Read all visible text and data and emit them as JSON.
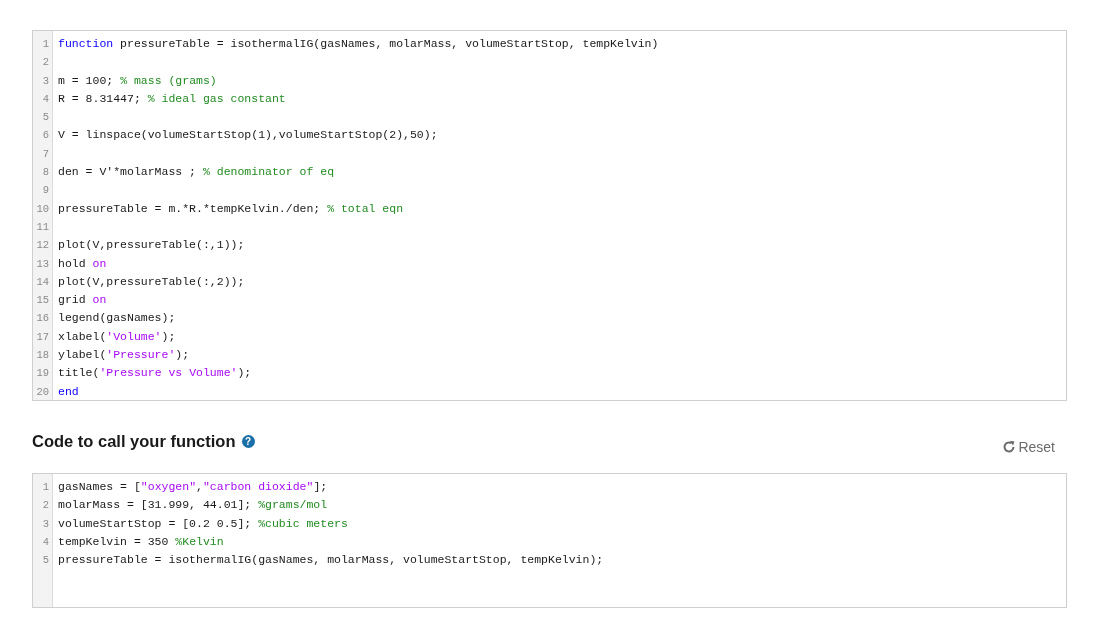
{
  "function_editor": {
    "lines": [
      {
        "number": "1",
        "tokens": [
          {
            "kind": "keyword",
            "text": "function"
          },
          {
            "kind": "code",
            "text": " pressureTable = isothermalIG(gasNames, molarMass, volumeStartStop, tempKelvin)"
          }
        ]
      },
      {
        "number": "2"
      },
      {
        "number": "3",
        "tokens": [
          {
            "kind": "code",
            "text": "m = 100; "
          },
          {
            "kind": "comment",
            "text": "% mass (grams)"
          }
        ]
      },
      {
        "number": "4",
        "tokens": [
          {
            "kind": "code",
            "text": "R = 8.31447; "
          },
          {
            "kind": "comment",
            "text": "% ideal gas constant"
          }
        ]
      },
      {
        "number": "5"
      },
      {
        "number": "6",
        "tokens": [
          {
            "kind": "code",
            "text": "V = linspace(volumeStartStop(1),volumeStartStop(2),50);"
          }
        ]
      },
      {
        "number": "7"
      },
      {
        "number": "8",
        "tokens": [
          {
            "kind": "code",
            "text": "den = V'*molarMass ; "
          },
          {
            "kind": "comment",
            "text": "% denominator of eq"
          }
        ]
      },
      {
        "number": "9"
      },
      {
        "number": "10",
        "tokens": [
          {
            "kind": "code",
            "text": "pressureTable = m.*R.*tempKelvin./den; "
          },
          {
            "kind": "comment",
            "text": "% total eqn"
          }
        ]
      },
      {
        "number": "11"
      },
      {
        "number": "12",
        "tokens": [
          {
            "kind": "code",
            "text": "plot(V,pressureTable(:,1));"
          }
        ]
      },
      {
        "number": "13",
        "tokens": [
          {
            "kind": "code",
            "text": "hold "
          },
          {
            "kind": "string",
            "text": "on"
          }
        ]
      },
      {
        "number": "14",
        "tokens": [
          {
            "kind": "code",
            "text": "plot(V,pressureTable(:,2));"
          }
        ]
      },
      {
        "number": "15",
        "tokens": [
          {
            "kind": "code",
            "text": "grid "
          },
          {
            "kind": "string",
            "text": "on"
          }
        ]
      },
      {
        "number": "16",
        "tokens": [
          {
            "kind": "code",
            "text": "legend(gasNames);"
          }
        ]
      },
      {
        "number": "17",
        "tokens": [
          {
            "kind": "code",
            "text": "xlabel("
          },
          {
            "kind": "string",
            "text": "'Volume'"
          },
          {
            "kind": "code",
            "text": ");"
          }
        ]
      },
      {
        "number": "18",
        "tokens": [
          {
            "kind": "code",
            "text": "ylabel("
          },
          {
            "kind": "string",
            "text": "'Pressure'"
          },
          {
            "kind": "code",
            "text": ");"
          }
        ]
      },
      {
        "number": "19",
        "tokens": [
          {
            "kind": "code",
            "text": "title("
          },
          {
            "kind": "string",
            "text": "'Pressure vs Volume'"
          },
          {
            "kind": "code",
            "text": ");"
          }
        ]
      },
      {
        "number": "20",
        "tokens": [
          {
            "kind": "keyword",
            "text": "end"
          }
        ]
      }
    ]
  },
  "call_section": {
    "heading": "Code to call your function",
    "help_icon": "?",
    "reset_button": "Reset"
  },
  "call_editor": {
    "lines": [
      {
        "number": "1",
        "tokens": [
          {
            "kind": "code",
            "text": "gasNames = ["
          },
          {
            "kind": "string",
            "text": "\"oxygen\""
          },
          {
            "kind": "code",
            "text": ","
          },
          {
            "kind": "string",
            "text": "\"carbon dioxide\""
          },
          {
            "kind": "code",
            "text": "];"
          }
        ]
      },
      {
        "number": "2",
        "tokens": [
          {
            "kind": "code",
            "text": "molarMass = [31.999, 44.01]; "
          },
          {
            "kind": "comment",
            "text": "%grams/mol"
          }
        ]
      },
      {
        "number": "3",
        "tokens": [
          {
            "kind": "code",
            "text": "volumeStartStop = [0.2 0.5]; "
          },
          {
            "kind": "comment",
            "text": "%cubic meters"
          }
        ]
      },
      {
        "number": "4",
        "tokens": [
          {
            "kind": "code",
            "text": "tempKelvin = 350 "
          },
          {
            "kind": "comment",
            "text": "%Kelvin"
          }
        ]
      },
      {
        "number": "5",
        "tokens": [
          {
            "kind": "code",
            "text": "pressureTable = isothermalIG(gasNames, molarMass, volumeStartStop, tempKelvin);"
          }
        ]
      }
    ]
  }
}
